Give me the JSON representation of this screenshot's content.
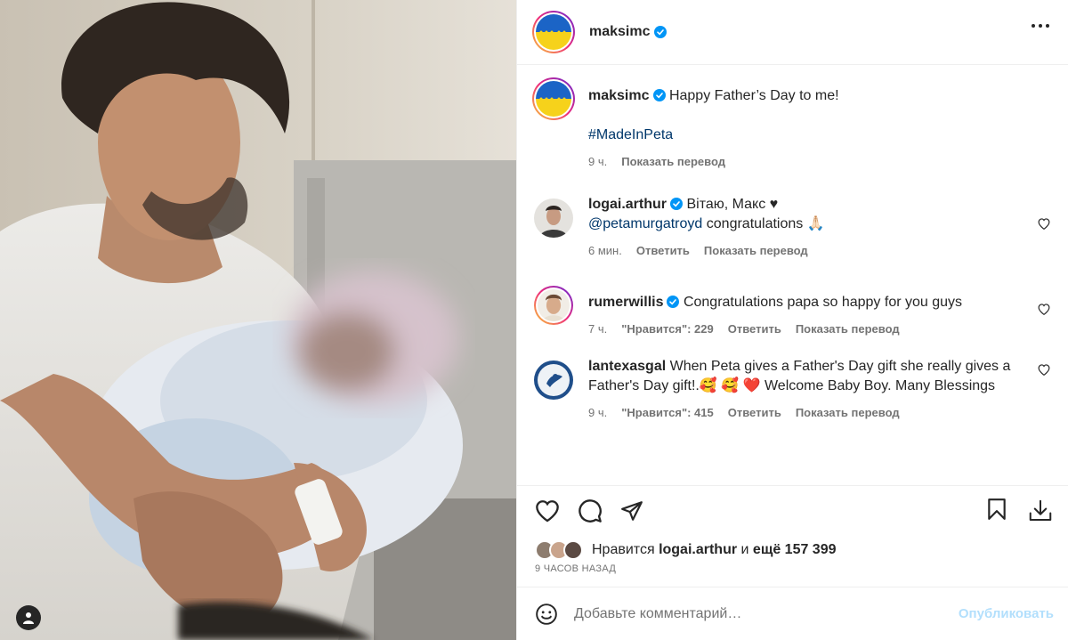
{
  "post": {
    "author": "maksimc",
    "caption_text": "Happy Father’s Day to me!",
    "hashtag": "#MadeInPeta",
    "caption_time": "9 ч.",
    "translate": "Показать перевод"
  },
  "comments": [
    {
      "user": "logai.arthur",
      "text": "Вітаю, Макс ♥",
      "mention": "@petamurgatroyd",
      "text2": "congratulations 🙏🏻",
      "time": "6 мин.",
      "reply": "Ответить",
      "translate": "Показать перевод"
    },
    {
      "user": "rumerwillis",
      "text": "Congratulations papa so happy for you guys",
      "time": "7 ч.",
      "likes": "\"Нравится\": 229",
      "reply": "Ответить",
      "translate": "Показать перевод"
    },
    {
      "user": "lantexasgal",
      "text": "When Peta gives a Father's Day gift she really gives a Father's Day gift!.🥰 🥰 ❤️  Welcome Baby Boy. Many Blessings",
      "time": "9 ч.",
      "likes": "\"Нравится\": 415",
      "reply": "Ответить",
      "translate": "Показать перевод"
    }
  ],
  "likes": {
    "prefix": "Нравится",
    "user": "logai.arthur",
    "middle": "и",
    "rest": "ещё 157 399"
  },
  "timestamp": "9 ЧАСОВ НАЗАД",
  "composer": {
    "placeholder": "Добавьте комментарий…",
    "publish": "Опубликовать"
  },
  "colors": {
    "accent": "#0095f6",
    "publish_disabled": "#b2dffc",
    "secondary_text": "#737373",
    "link": "#00376b"
  },
  "icons": [
    "more-icon",
    "verified-icon",
    "like-icon",
    "comment-icon",
    "share-icon",
    "save-icon",
    "download-icon",
    "emoji-icon",
    "heart-small-icon",
    "user-tag-icon"
  ]
}
